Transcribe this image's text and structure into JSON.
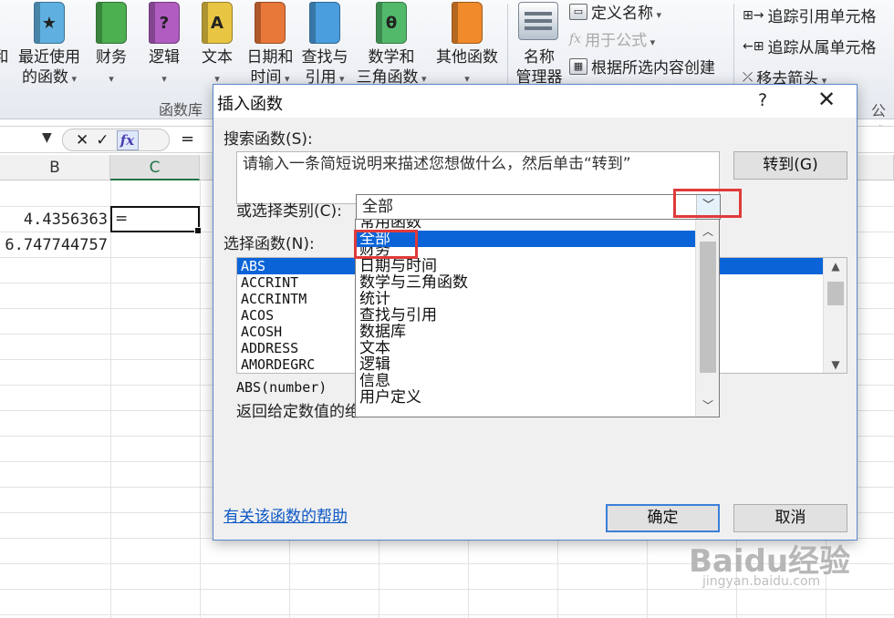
{
  "ribbon": {
    "buttons": [
      {
        "label1": "和",
        "label2": "",
        "color": "#4f86c6"
      },
      {
        "label1": "最近使用",
        "label2": "的函数",
        "color": "#5fb0e0",
        "glyph": "★"
      },
      {
        "label1": "财务",
        "label2": "",
        "color": "#4caf50",
        "glyph": ""
      },
      {
        "label1": "逻辑",
        "label2": "",
        "color": "#b05cc0",
        "glyph": "?"
      },
      {
        "label1": "文本",
        "label2": "",
        "color": "#e8c542",
        "glyph": "A"
      },
      {
        "label1": "日期和",
        "label2": "时间",
        "color": "#e8773a",
        "glyph": ""
      },
      {
        "label1": "查找与",
        "label2": "引用",
        "color": "#4a9ede",
        "glyph": ""
      },
      {
        "label1": "数学和",
        "label2": "三角函数",
        "color": "#52b96b",
        "glyph": "θ"
      },
      {
        "label1": "其他函数",
        "label2": "",
        "color": "#f08a2b",
        "glyph": ""
      }
    ],
    "group_label": "函数库",
    "name_manager_line1": "名称",
    "name_manager_line2": "管理器",
    "define_name": "定义名称",
    "use_in_formula": "用于公式",
    "create_from_selection": "根据所选内容创建",
    "trace_precedents": "追踪引用单元格",
    "trace_dependents": "追踪从属单元格",
    "remove_arrows": "移去箭头",
    "formula_group_partial": "公式"
  },
  "formula_bar": {
    "cancel": "✕",
    "enter": "✓",
    "fx": "fx",
    "content": "="
  },
  "grid": {
    "columns": [
      "B",
      "C"
    ],
    "cells": {
      "b1": "4.4356363",
      "b2": "6.747744757",
      "c1": "="
    }
  },
  "dialog": {
    "title": "插入函数",
    "help": "?",
    "close": "✕",
    "search_label": "搜索函数(S):",
    "search_text": "请输入一条简短说明来描述您想做什么，然后单击“转到”",
    "go_button": "转到(G)",
    "category_label": "或选择类别(C):",
    "category_value": "全部",
    "function_label": "选择函数(N):",
    "functions": [
      "ABS",
      "ACCRINT",
      "ACCRINTM",
      "ACOS",
      "ACOSH",
      "ADDRESS",
      "AMORDEGRC"
    ],
    "selected_function": "ABS",
    "signature": "ABS(number)",
    "description": "返回给定数值的绝",
    "help_link": "有关该函数的帮助",
    "ok_button": "确定",
    "cancel_button": "取消"
  },
  "category_dropdown": {
    "options": [
      "常用函数",
      "全部",
      "财务",
      "日期与时间",
      "数学与三角函数",
      "统计",
      "查找与引用",
      "数据库",
      "文本",
      "逻辑",
      "信息",
      "用户定义"
    ],
    "selected": "全部"
  },
  "watermark": {
    "main": "Baidu经验",
    "sub": "jingyan.baidu.com"
  },
  "colors": {
    "selection_blue": "#0a64d8",
    "highlight_red": "#e03a3a",
    "excel_green": "#217346"
  }
}
